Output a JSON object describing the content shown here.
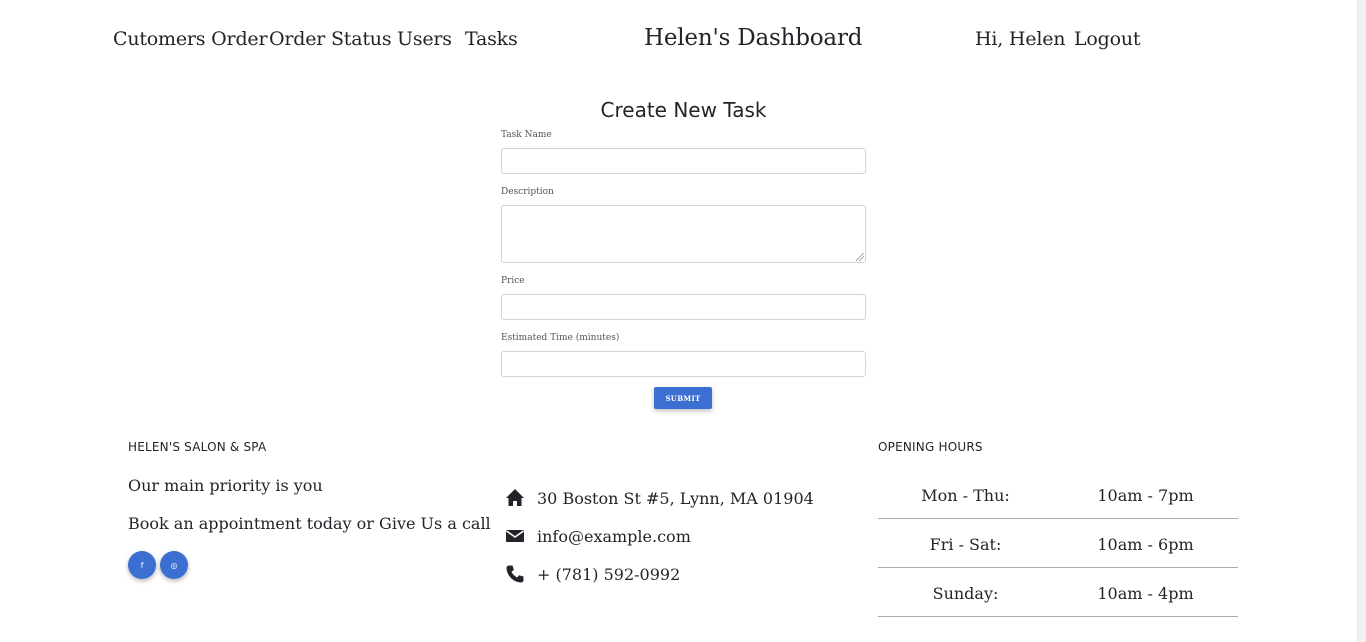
{
  "nav": {
    "links": [
      "Cutomers Order",
      "Order Status",
      "Users",
      "Tasks"
    ],
    "brand": "Helen's Dashboard",
    "greeting": "Hi, Helen",
    "logout": "Logout"
  },
  "form": {
    "title": "Create New Task",
    "fields": [
      {
        "label": "Task Name",
        "value": ""
      },
      {
        "label": "Description",
        "value": ""
      },
      {
        "label": "Price",
        "value": ""
      },
      {
        "label": "Estimated Time (minutes)",
        "value": ""
      }
    ],
    "submit": "Submit"
  },
  "footer": {
    "about": {
      "heading": "HELEN'S SALON & SPA",
      "line1": "Our main priority is you",
      "line2": "Book an appointment today or Give Us a call",
      "social": [
        {
          "icon": "facebook-icon",
          "glyph": "f"
        },
        {
          "icon": "instagram-icon",
          "glyph": "◎"
        }
      ]
    },
    "contact": {
      "address": "30 Boston St #5, Lynn, MA 01904",
      "email": "info@example.com",
      "phone": "+ (781) 592-0992"
    },
    "hours": {
      "heading": "OPENING HOURS",
      "rows": [
        {
          "day": "Mon - Thu:",
          "time": "10am - 7pm"
        },
        {
          "day": "Fri - Sat:",
          "time": "10am - 6pm"
        },
        {
          "day": "Sunday:",
          "time": "10am - 4pm"
        }
      ]
    }
  },
  "colors": {
    "accent": "#3b6fd1",
    "text": "#212529",
    "border": "#ced4da"
  }
}
